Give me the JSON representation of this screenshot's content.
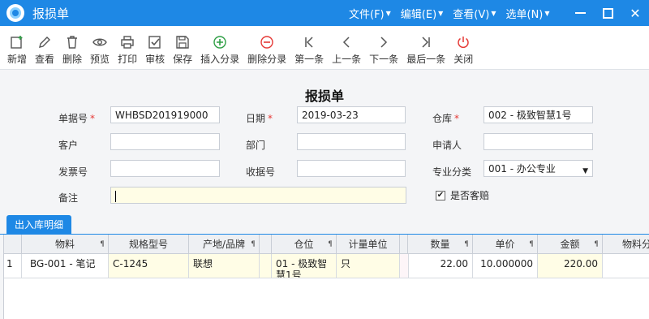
{
  "window": {
    "title": "报损单",
    "menus": [
      "文件(F)",
      "编辑(E)",
      "查看(V)",
      "选单(N)"
    ],
    "close_glyph": "✕"
  },
  "toolbar": {
    "buttons": [
      {
        "label": "新增",
        "icon": "new-icon"
      },
      {
        "label": "查看",
        "icon": "edit-icon"
      },
      {
        "label": "删除",
        "icon": "trash-icon"
      },
      {
        "label": "预览",
        "icon": "eye-icon"
      },
      {
        "label": "打印",
        "icon": "printer-icon"
      },
      {
        "label": "审核",
        "icon": "check-icon"
      },
      {
        "label": "保存",
        "icon": "save-icon"
      },
      {
        "label": "插入分录",
        "icon": "plus-circle-icon"
      },
      {
        "label": "删除分录",
        "icon": "minus-circle-icon"
      },
      {
        "label": "第一条",
        "icon": "first-icon"
      },
      {
        "label": "上一条",
        "icon": "prev-icon"
      },
      {
        "label": "下一条",
        "icon": "next-icon"
      },
      {
        "label": "最后一条",
        "icon": "last-icon"
      },
      {
        "label": "关闭",
        "icon": "power-icon"
      }
    ]
  },
  "form": {
    "title": "报损单",
    "doc_no_label": "单据号",
    "doc_no_value": "WHBSD201919000",
    "date_label": "日期",
    "date_value": "2019-03-23",
    "warehouse_label": "仓库",
    "warehouse_value": "002 - 极致智慧1号",
    "customer_label": "客户",
    "customer_value": "",
    "department_label": "部门",
    "department_value": "",
    "applicant_label": "申请人",
    "applicant_value": "",
    "invoice_label": "发票号",
    "invoice_value": "",
    "receipt_label": "收据号",
    "receipt_value": "",
    "category_label": "专业分类",
    "category_value": "001 - 办公专业",
    "remark_label": "备注",
    "remark_value": "",
    "compensation_label": "是否客赔",
    "compensation_checked": true,
    "required_mark": "*",
    "check_glyph": "✔"
  },
  "tabs": [
    "出入库明细"
  ],
  "grid": {
    "columns": [
      "物料",
      "规格型号",
      "产地/品牌",
      "仓位",
      "计量单位",
      "数量",
      "单价",
      "金额",
      "物料分"
    ],
    "rows": [
      {
        "index": "1",
        "material": "BG-001 - 笔记",
        "spec": "C-1245",
        "brand": "联想",
        "location": "01 - 极致智慧1号",
        "unit": "只",
        "quantity": "22.00",
        "price": "10.000000",
        "amount": "220.00",
        "category": ""
      }
    ]
  },
  "colors": {
    "titlebar": "#1e88e5",
    "required": "#e53935",
    "input_highlight": "#fffde6"
  }
}
